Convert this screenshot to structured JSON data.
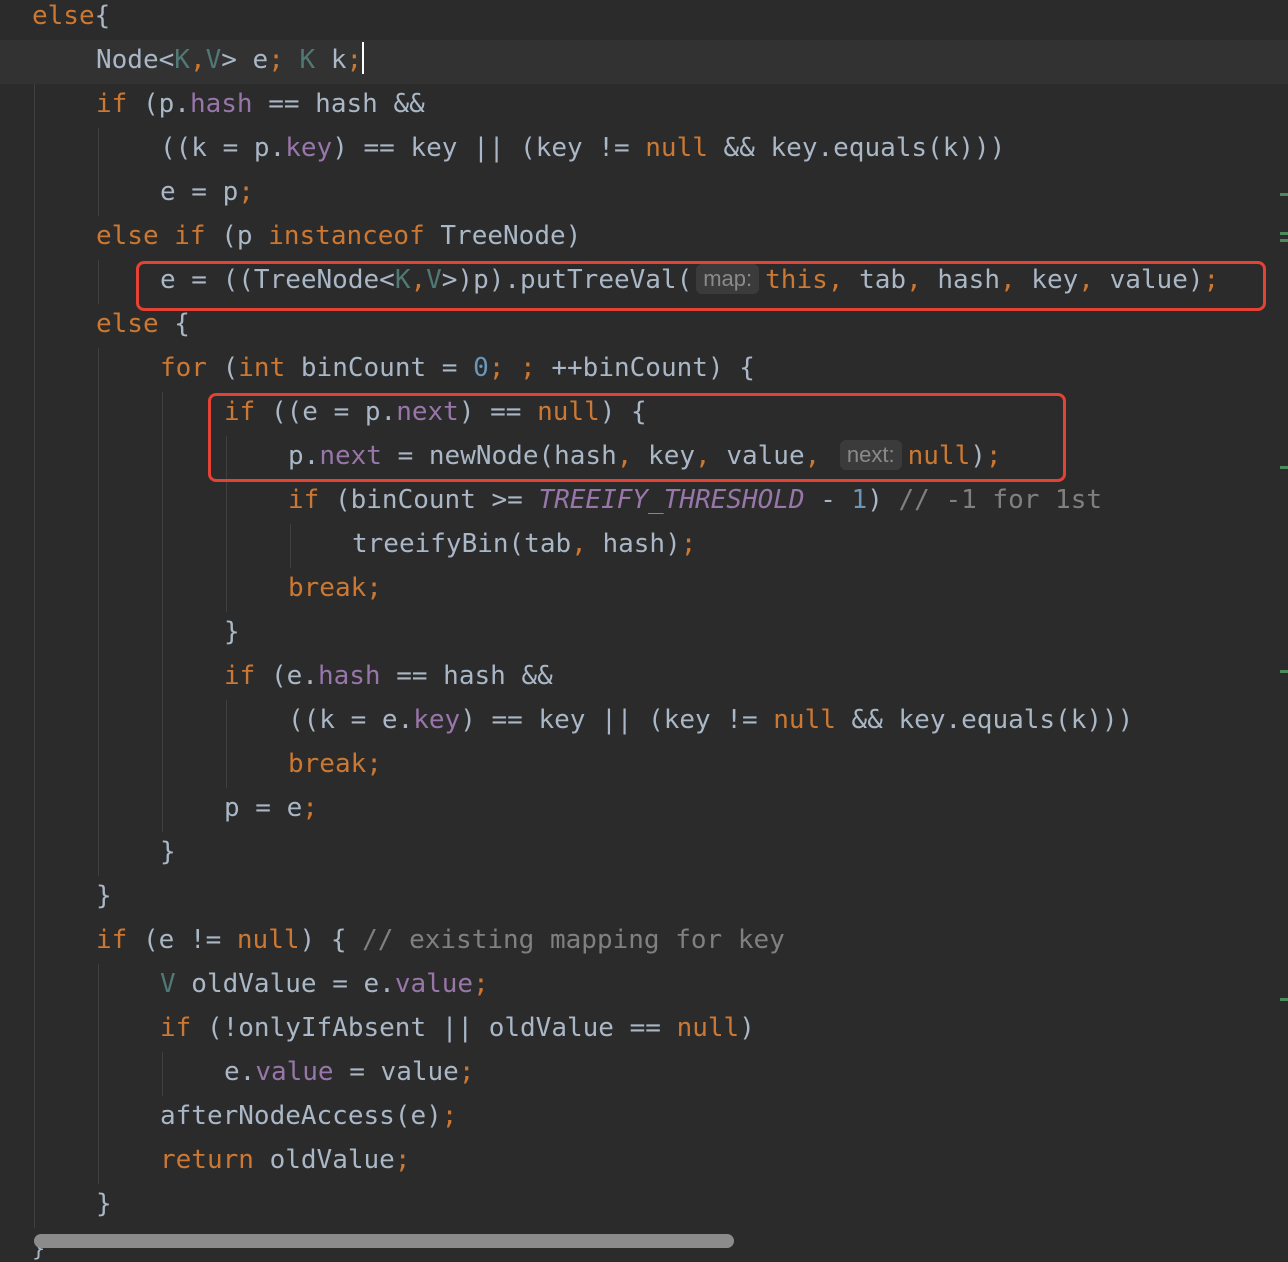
{
  "colors": {
    "background": "#2b2b2b",
    "current_line": "#323232",
    "keyword": "#cc7832",
    "field": "#9876aa",
    "type_param": "#507874",
    "number": "#6897bb",
    "comment": "#808080",
    "default_text": "#a9b7c6",
    "highlight_border": "#e34234"
  },
  "editor": {
    "lines": [
      {
        "indent": 1,
        "tokens": [
          [
            "kw",
            "else"
          ],
          [
            "",
            "{"
          ]
        ]
      },
      {
        "indent": 3,
        "current": true,
        "caret": true,
        "tokens": [
          [
            "",
            "Node<"
          ],
          [
            "tp",
            "K"
          ],
          [
            "kw",
            ","
          ],
          [
            "tp",
            "V"
          ],
          [
            "",
            "> e"
          ],
          [
            "kw",
            ";"
          ],
          [
            "",
            " "
          ],
          [
            "tp",
            "K"
          ],
          [
            "",
            " k"
          ],
          [
            "kw",
            ";"
          ]
        ]
      },
      {
        "indent": 3,
        "tokens": [
          [
            "kw",
            "if"
          ],
          [
            "",
            " (p."
          ],
          [
            "fld",
            "hash"
          ],
          [
            "",
            " == hash &&"
          ]
        ]
      },
      {
        "indent": 5,
        "tokens": [
          [
            "",
            "((k = p."
          ],
          [
            "fld",
            "key"
          ],
          [
            "",
            ") == key || (key != "
          ],
          [
            "kw",
            "null"
          ],
          [
            "",
            " && key.equals(k)))"
          ]
        ]
      },
      {
        "indent": 5,
        "tokens": [
          [
            "",
            "e = p"
          ],
          [
            "kw",
            ";"
          ]
        ]
      },
      {
        "indent": 3,
        "tokens": [
          [
            "kw",
            "else if"
          ],
          [
            "",
            " (p "
          ],
          [
            "kw",
            "instanceof"
          ],
          [
            "",
            " TreeNode)"
          ]
        ]
      },
      {
        "indent": 5,
        "tokens": [
          [
            "",
            "e = ((TreeNode<"
          ],
          [
            "tp",
            "K"
          ],
          [
            "kw",
            ","
          ],
          [
            "tp",
            "V"
          ],
          [
            "",
            ">)p).putTreeVal("
          ],
          [
            "hint",
            "map:"
          ],
          [
            "kw",
            "this,"
          ],
          [
            "",
            " tab"
          ],
          [
            "kw",
            ","
          ],
          [
            "",
            " hash"
          ],
          [
            "kw",
            ","
          ],
          [
            "",
            " key"
          ],
          [
            "kw",
            ","
          ],
          [
            "",
            " value)"
          ],
          [
            "kw",
            ";"
          ]
        ]
      },
      {
        "indent": 3,
        "tokens": [
          [
            "kw",
            "else"
          ],
          [
            "",
            " {"
          ]
        ]
      },
      {
        "indent": 5,
        "tokens": [
          [
            "kw",
            "for"
          ],
          [
            "",
            " ("
          ],
          [
            "kw",
            "int"
          ],
          [
            "",
            " binCount = "
          ],
          [
            "num",
            "0"
          ],
          [
            "kw",
            "; ;"
          ],
          [
            "",
            " ++binCount) {"
          ]
        ]
      },
      {
        "indent": 7,
        "tokens": [
          [
            "kw",
            "if"
          ],
          [
            "",
            " ((e = p."
          ],
          [
            "fld",
            "next"
          ],
          [
            "",
            ") == "
          ],
          [
            "kw",
            "null"
          ],
          [
            "",
            ") {"
          ]
        ]
      },
      {
        "indent": 9,
        "tokens": [
          [
            "",
            "p."
          ],
          [
            "fld",
            "next"
          ],
          [
            "",
            " = newNode(hash"
          ],
          [
            "kw",
            ","
          ],
          [
            "",
            " key"
          ],
          [
            "kw",
            ","
          ],
          [
            "",
            " value"
          ],
          [
            "kw",
            ","
          ],
          [
            "",
            " "
          ],
          [
            "hint",
            "next:"
          ],
          [
            "kw",
            "null"
          ],
          [
            "",
            ")"
          ],
          [
            "kw",
            ";"
          ]
        ]
      },
      {
        "indent": 9,
        "tokens": [
          [
            "kw",
            "if"
          ],
          [
            "",
            " (binCount >= "
          ],
          [
            "cst",
            "TREEIFY_THRESHOLD"
          ],
          [
            "",
            " - "
          ],
          [
            "num",
            "1"
          ],
          [
            "",
            ") "
          ],
          [
            "cm",
            "// -1 for 1st"
          ]
        ]
      },
      {
        "indent": 11,
        "tokens": [
          [
            "",
            "treeifyBin(tab"
          ],
          [
            "kw",
            ","
          ],
          [
            "",
            " hash)"
          ],
          [
            "kw",
            ";"
          ]
        ]
      },
      {
        "indent": 9,
        "tokens": [
          [
            "kw",
            "break;"
          ]
        ]
      },
      {
        "indent": 7,
        "tokens": [
          [
            "",
            "}"
          ]
        ]
      },
      {
        "indent": 7,
        "tokens": [
          [
            "kw",
            "if"
          ],
          [
            "",
            " (e."
          ],
          [
            "fld",
            "hash"
          ],
          [
            "",
            " == hash &&"
          ]
        ]
      },
      {
        "indent": 9,
        "tokens": [
          [
            "",
            "((k = e."
          ],
          [
            "fld",
            "key"
          ],
          [
            "",
            ") == key || (key != "
          ],
          [
            "kw",
            "null"
          ],
          [
            "",
            " && key.equals(k)))"
          ]
        ]
      },
      {
        "indent": 9,
        "tokens": [
          [
            "kw",
            "break;"
          ]
        ]
      },
      {
        "indent": 7,
        "tokens": [
          [
            "",
            "p = e"
          ],
          [
            "kw",
            ";"
          ]
        ]
      },
      {
        "indent": 5,
        "tokens": [
          [
            "",
            "}"
          ]
        ]
      },
      {
        "indent": 3,
        "tokens": [
          [
            "",
            "}"
          ]
        ]
      },
      {
        "indent": 3,
        "tokens": [
          [
            "kw",
            "if"
          ],
          [
            "",
            " (e != "
          ],
          [
            "kw",
            "null"
          ],
          [
            "",
            ") { "
          ],
          [
            "cm",
            "// existing mapping for key"
          ]
        ]
      },
      {
        "indent": 5,
        "tokens": [
          [
            "tp",
            "V"
          ],
          [
            "",
            " oldValue = e."
          ],
          [
            "fld",
            "value"
          ],
          [
            "kw",
            ";"
          ]
        ]
      },
      {
        "indent": 5,
        "tokens": [
          [
            "kw",
            "if"
          ],
          [
            "",
            " (!onlyIfAbsent || oldValue == "
          ],
          [
            "kw",
            "null"
          ],
          [
            "",
            ")"
          ]
        ]
      },
      {
        "indent": 7,
        "tokens": [
          [
            "",
            "e."
          ],
          [
            "fld",
            "value"
          ],
          [
            "",
            " = value"
          ],
          [
            "kw",
            ";"
          ]
        ]
      },
      {
        "indent": 5,
        "tokens": [
          [
            "",
            "afterNodeAccess(e)"
          ],
          [
            "kw",
            ";"
          ]
        ]
      },
      {
        "indent": 5,
        "tokens": [
          [
            "kw",
            "return"
          ],
          [
            "",
            " oldValue"
          ],
          [
            "kw",
            ";"
          ]
        ]
      },
      {
        "indent": 3,
        "tokens": [
          [
            "",
            "}"
          ]
        ]
      }
    ],
    "corner_glyph": "}"
  }
}
